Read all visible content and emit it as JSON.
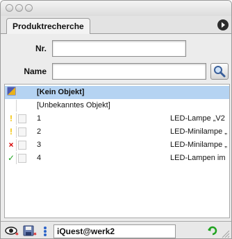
{
  "window": {
    "title": ""
  },
  "tab": {
    "label": "Produktrecherche"
  },
  "form": {
    "nr_label": "Nr.",
    "nr_value": "",
    "name_label": "Name",
    "name_value": ""
  },
  "list": {
    "items": [
      {
        "status": "type",
        "check": "",
        "label": "[Kein Objekt]",
        "desc": "",
        "bold": true,
        "selected": true
      },
      {
        "status": "",
        "check": "",
        "label": "[Unbekanntes Objekt]",
        "desc": "",
        "bold": false,
        "selected": false
      },
      {
        "status": "!",
        "check": "",
        "label": "1",
        "desc": "LED-Lampe „V2",
        "bold": false,
        "selected": false
      },
      {
        "status": "!",
        "check": "",
        "label": "2",
        "desc": "LED-Minilampe „",
        "bold": false,
        "selected": false
      },
      {
        "status": "×",
        "check": "",
        "label": "3",
        "desc": "LED-Minilampe „",
        "bold": false,
        "selected": false
      },
      {
        "status": "✓",
        "check": "",
        "label": "4",
        "desc": "LED-Lampen im",
        "bold": false,
        "selected": false
      }
    ]
  },
  "status_bar": {
    "user_text": "iQuest@werk2"
  },
  "colors": {
    "selection": "#b5d3f2",
    "warning": "#f2c200",
    "error": "#d60000",
    "ok": "#1fa31f"
  }
}
